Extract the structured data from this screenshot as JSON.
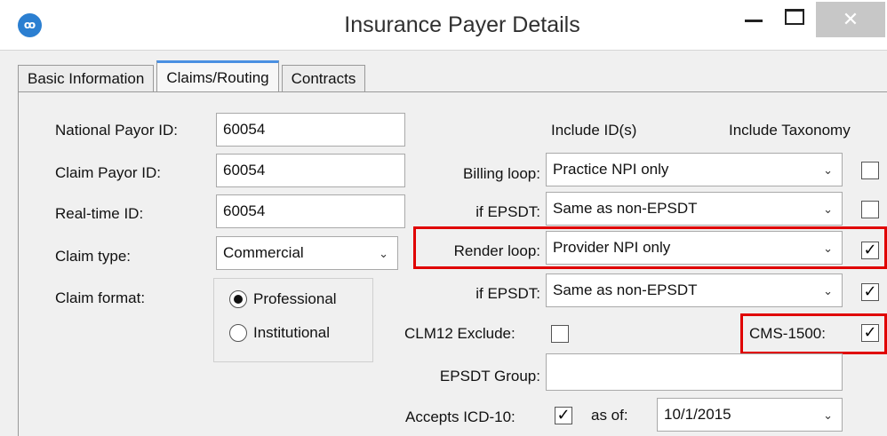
{
  "window": {
    "title": "Insurance Payer Details",
    "logo_text": "ꝏ",
    "minimize_glyph": "",
    "close_glyph": "✕"
  },
  "tabs": [
    {
      "label": "Basic Information",
      "active": false
    },
    {
      "label": "Claims/Routing",
      "active": true
    },
    {
      "label": "Contracts",
      "active": false
    }
  ],
  "left": {
    "national_payor_id": {
      "label": "National Payor ID:",
      "value": "60054"
    },
    "claim_payor_id": {
      "label": "Claim Payor ID:",
      "value": "60054"
    },
    "realtime_id": {
      "label": "Real-time ID:",
      "value": "60054"
    },
    "claim_type": {
      "label": "Claim type:",
      "value": "Commercial"
    },
    "claim_format": {
      "label": "Claim format:",
      "options": [
        {
          "label": "Professional",
          "selected": true
        },
        {
          "label": "Institutional",
          "selected": false
        }
      ]
    }
  },
  "right": {
    "header_include_ids": "Include ID(s)",
    "header_include_taxonomy": "Include Taxonomy",
    "billing_loop": {
      "label": "Billing loop:",
      "value": "Practice NPI only",
      "taxonomy_checked": false
    },
    "billing_epsdt": {
      "label": "if EPSDT:",
      "value": "Same as non-EPSDT",
      "taxonomy_checked": false
    },
    "render_loop": {
      "label": "Render loop:",
      "value": "Provider NPI only",
      "taxonomy_checked": true
    },
    "render_epsdt": {
      "label": "if EPSDT:",
      "value": "Same as non-EPSDT",
      "taxonomy_checked": true
    },
    "clm12_exclude": {
      "label": "CLM12 Exclude:",
      "checked": false
    },
    "cms1500": {
      "label": "CMS-1500:",
      "checked": true
    },
    "epsdt_group": {
      "label": "EPSDT Group:",
      "value": ""
    },
    "accepts_icd10": {
      "label": "Accepts ICD-10:",
      "checked": true,
      "as_of_label": "as of:",
      "as_of_value": "10/1/2015"
    }
  },
  "glyphs": {
    "check": "✓",
    "chevron": "⌄"
  },
  "colors": {
    "highlight": "#e00000",
    "tab_accent": "#4a90e2",
    "logo": "#2b7fd1"
  }
}
